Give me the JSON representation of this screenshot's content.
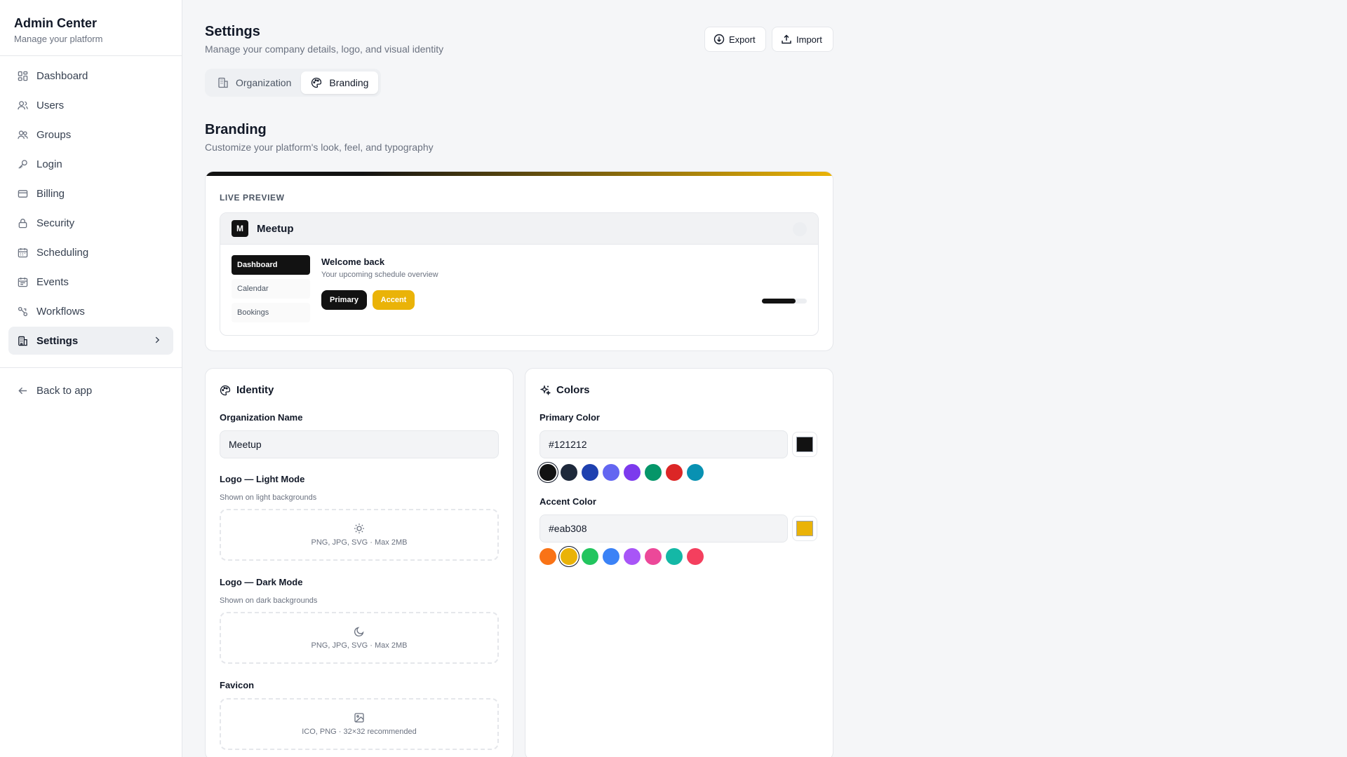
{
  "sidebar": {
    "title": "Admin Center",
    "subtitle": "Manage your platform",
    "items": [
      {
        "label": "Dashboard",
        "icon": "dashboard-icon"
      },
      {
        "label": "Users",
        "icon": "user-icon"
      },
      {
        "label": "Groups",
        "icon": "users-icon"
      },
      {
        "label": "Login",
        "icon": "key-icon"
      },
      {
        "label": "Billing",
        "icon": "credit-card-icon"
      },
      {
        "label": "Security",
        "icon": "lock-icon"
      },
      {
        "label": "Scheduling",
        "icon": "calendar-icon"
      },
      {
        "label": "Events",
        "icon": "calendar-icon"
      },
      {
        "label": "Workflows",
        "icon": "workflow-icon"
      },
      {
        "label": "Settings",
        "icon": "building-icon",
        "active": true
      }
    ],
    "back_label": "Back to app"
  },
  "header": {
    "title": "Settings",
    "subtitle": "Manage your company details, logo, and visual identity",
    "export_label": "Export",
    "import_label": "Import"
  },
  "tabs": [
    {
      "label": "Organization"
    },
    {
      "label": "Branding",
      "active": true
    }
  ],
  "branding": {
    "title": "Branding",
    "subtitle": "Customize your platform's look, feel, and typography"
  },
  "preview": {
    "label": "LIVE PREVIEW",
    "logo_letter": "M",
    "app_name": "Meetup",
    "nav": [
      "Dashboard",
      "Calendar",
      "Bookings"
    ],
    "welcome": "Welcome back",
    "welcome_sub": "Your upcoming schedule overview",
    "primary_label": "Primary",
    "accent_label": "Accent",
    "progress": 0.75
  },
  "identity": {
    "title": "Identity",
    "org_label": "Organization Name",
    "org_value": "Meetup",
    "logo_light_label": "Logo — Light Mode",
    "logo_light_hint": "Shown on light backgrounds",
    "logo_light_text": "PNG, JPG, SVG · Max 2MB",
    "logo_dark_label": "Logo — Dark Mode",
    "logo_dark_hint": "Shown on dark backgrounds",
    "logo_dark_text": "PNG, JPG, SVG · Max 2MB",
    "favicon_label": "Favicon",
    "favicon_text": "ICO, PNG · 32×32 recommended"
  },
  "colors": {
    "title": "Colors",
    "primary_label": "Primary Color",
    "primary_value": "#121212",
    "primary_swatches": [
      "#121212",
      "#1e293b",
      "#1e40af",
      "#6366f1",
      "#7c3aed",
      "#059669",
      "#dc2626",
      "#0891b2"
    ],
    "accent_label": "Accent Color",
    "accent_value": "#eab308",
    "accent_swatches": [
      "#f97316",
      "#eab308",
      "#22c55e",
      "#3b82f6",
      "#a855f7",
      "#ec4899",
      "#14b8a6",
      "#f43f5e"
    ]
  }
}
